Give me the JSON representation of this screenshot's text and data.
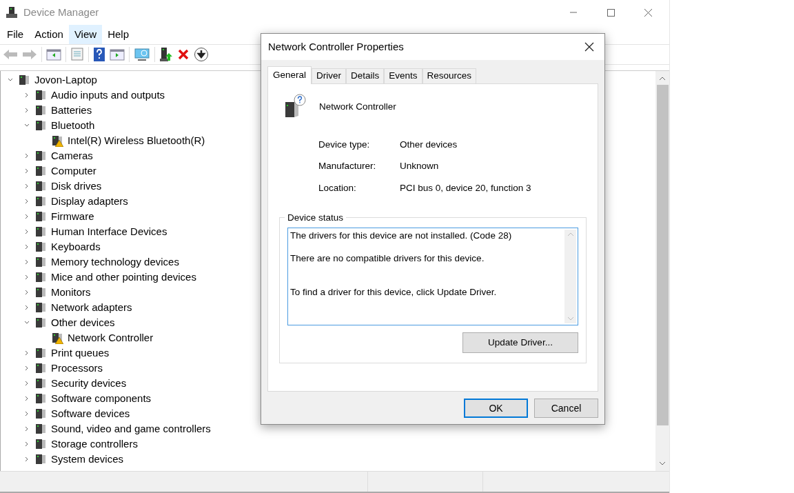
{
  "window": {
    "title": "Device Manager"
  },
  "menu": [
    {
      "label": "File",
      "selected": false
    },
    {
      "label": "Action",
      "selected": false
    },
    {
      "label": "View",
      "selected": true
    },
    {
      "label": "Help",
      "selected": false
    }
  ],
  "tree": {
    "label": "Jovon-Laptop",
    "expanded": true,
    "children": [
      {
        "label": "Audio inputs and outputs",
        "expanded": false
      },
      {
        "label": "Batteries",
        "expanded": false
      },
      {
        "label": "Bluetooth",
        "expanded": true,
        "children": [
          {
            "label": "Intel(R) Wireless Bluetooth(R)",
            "warning": true
          }
        ]
      },
      {
        "label": "Cameras",
        "expanded": false
      },
      {
        "label": "Computer",
        "expanded": false
      },
      {
        "label": "Disk drives",
        "expanded": false
      },
      {
        "label": "Display adapters",
        "expanded": false
      },
      {
        "label": "Firmware",
        "expanded": false
      },
      {
        "label": "Human Interface Devices",
        "expanded": false
      },
      {
        "label": "Keyboards",
        "expanded": false
      },
      {
        "label": "Memory technology devices",
        "expanded": false
      },
      {
        "label": "Mice and other pointing devices",
        "expanded": false
      },
      {
        "label": "Monitors",
        "expanded": false
      },
      {
        "label": "Network adapters",
        "expanded": false
      },
      {
        "label": "Other devices",
        "expanded": true,
        "children": [
          {
            "label": "Network Controller",
            "warning": true
          }
        ]
      },
      {
        "label": "Print queues",
        "expanded": false
      },
      {
        "label": "Processors",
        "expanded": false
      },
      {
        "label": "Security devices",
        "expanded": false
      },
      {
        "label": "Software components",
        "expanded": false
      },
      {
        "label": "Software devices",
        "expanded": false
      },
      {
        "label": "Sound, video and game controllers",
        "expanded": false
      },
      {
        "label": "Storage controllers",
        "expanded": false
      },
      {
        "label": "System devices",
        "expanded": false
      }
    ]
  },
  "dialog": {
    "title": "Network Controller Properties",
    "tabs": [
      {
        "label": "General",
        "selected": true
      },
      {
        "label": "Driver",
        "selected": false
      },
      {
        "label": "Details",
        "selected": false
      },
      {
        "label": "Events",
        "selected": false
      },
      {
        "label": "Resources",
        "selected": false
      }
    ],
    "device_name": "Network Controller",
    "properties": [
      {
        "label": "Device type:",
        "value": "Other devices"
      },
      {
        "label": "Manufacturer:",
        "value": "Unknown"
      },
      {
        "label": "Location:",
        "value": "PCI bus 0, device 20, function 3"
      }
    ],
    "status_title": "Device status",
    "status_lines": [
      "The drivers for this device are not installed. (Code 28)",
      "There are no compatible drivers for this device.",
      "To find a driver for this device, click Update Driver."
    ],
    "update_button": "Update Driver...",
    "buttons": [
      {
        "label": "OK",
        "default": true
      },
      {
        "label": "Cancel",
        "default": false
      }
    ]
  }
}
